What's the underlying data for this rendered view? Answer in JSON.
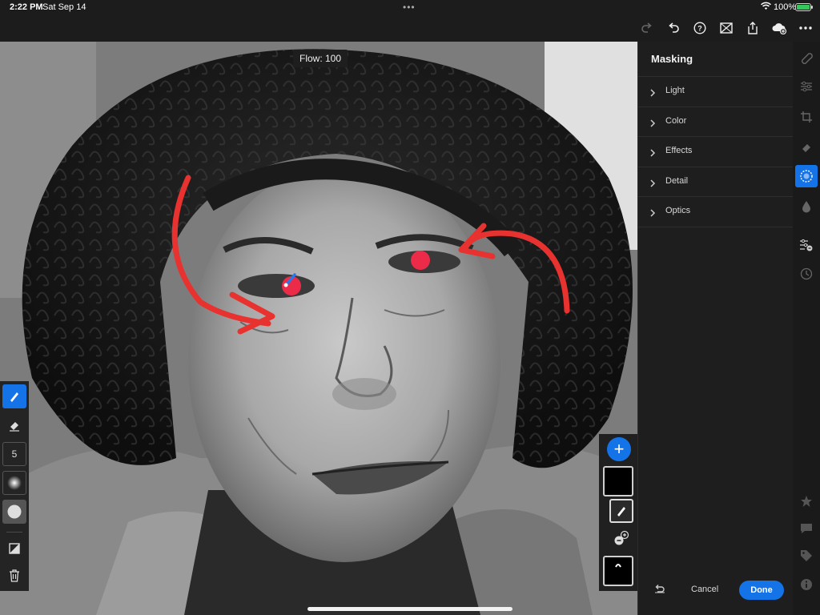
{
  "status_bar": {
    "time": "2:22 PM",
    "date": "Sat Sep 14",
    "battery_percent": "100%",
    "battery_level": 1.0,
    "battery_color": "#34c759"
  },
  "toolbar": {
    "icons": [
      "redo-icon",
      "undo-icon",
      "help-icon",
      "compare-icon",
      "share-icon",
      "cloud-sync-icon",
      "more-icon"
    ]
  },
  "canvas": {
    "flow_label": "Flow: 100",
    "mask_overlay_color": "#ff2a4a",
    "annotation_color": "#e8322f"
  },
  "brush_tools": {
    "brush_size_value": "5",
    "icons": [
      "brush-icon",
      "eraser-icon",
      "feather-icon",
      "flow-icon",
      "invert-icon",
      "trash-icon"
    ]
  },
  "masking_panel": {
    "title": "Masking",
    "sections": [
      {
        "label": "Light"
      },
      {
        "label": "Color"
      },
      {
        "label": "Effects"
      },
      {
        "label": "Detail"
      },
      {
        "label": "Optics"
      }
    ],
    "cancel_label": "Cancel",
    "done_label": "Done"
  },
  "colors": {
    "accent": "#1473e6",
    "panel_bg": "#1e1e1e"
  }
}
